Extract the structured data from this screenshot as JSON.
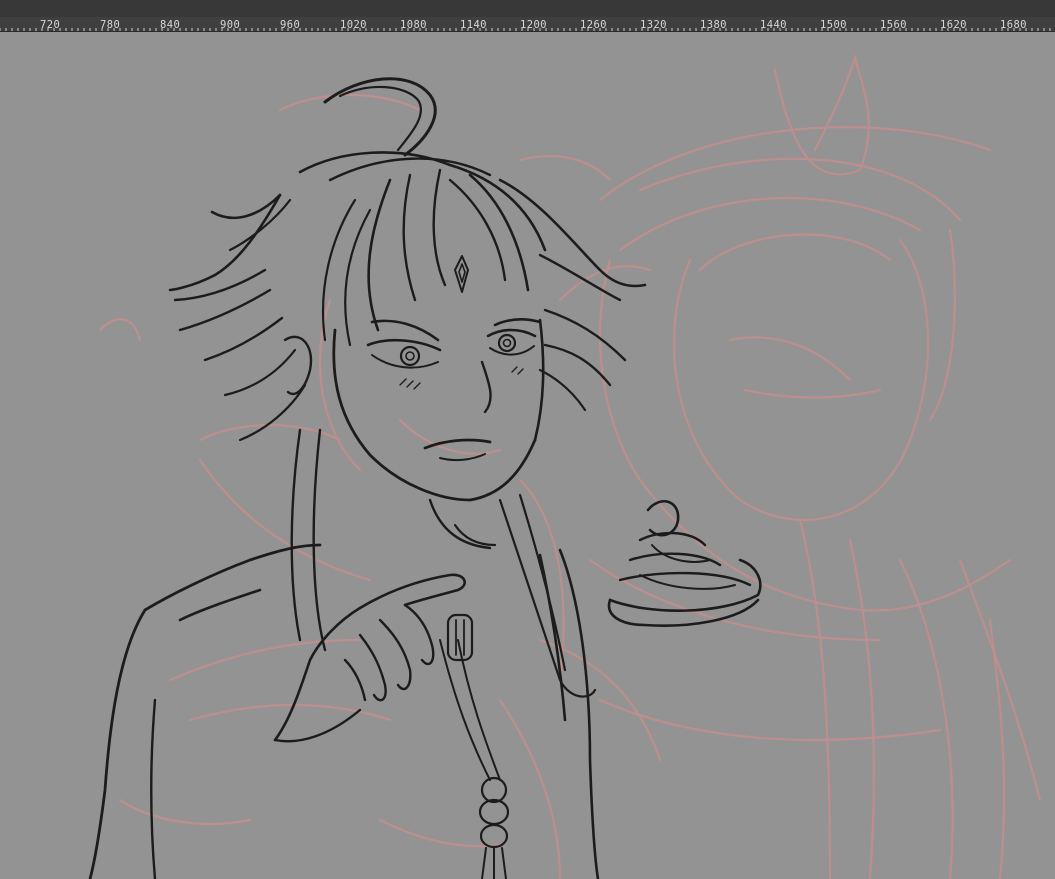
{
  "ruler": {
    "ticks": [
      "720",
      "780",
      "840",
      "900",
      "960",
      "1020",
      "1080",
      "1140",
      "1200",
      "1260",
      "1320",
      "1380",
      "1440",
      "1500",
      "1560",
      "1620",
      "1680"
    ]
  },
  "canvas": {
    "background": "#939393",
    "sketch_color": "#c48e8e",
    "lineart_color": "#1c1c1c"
  }
}
